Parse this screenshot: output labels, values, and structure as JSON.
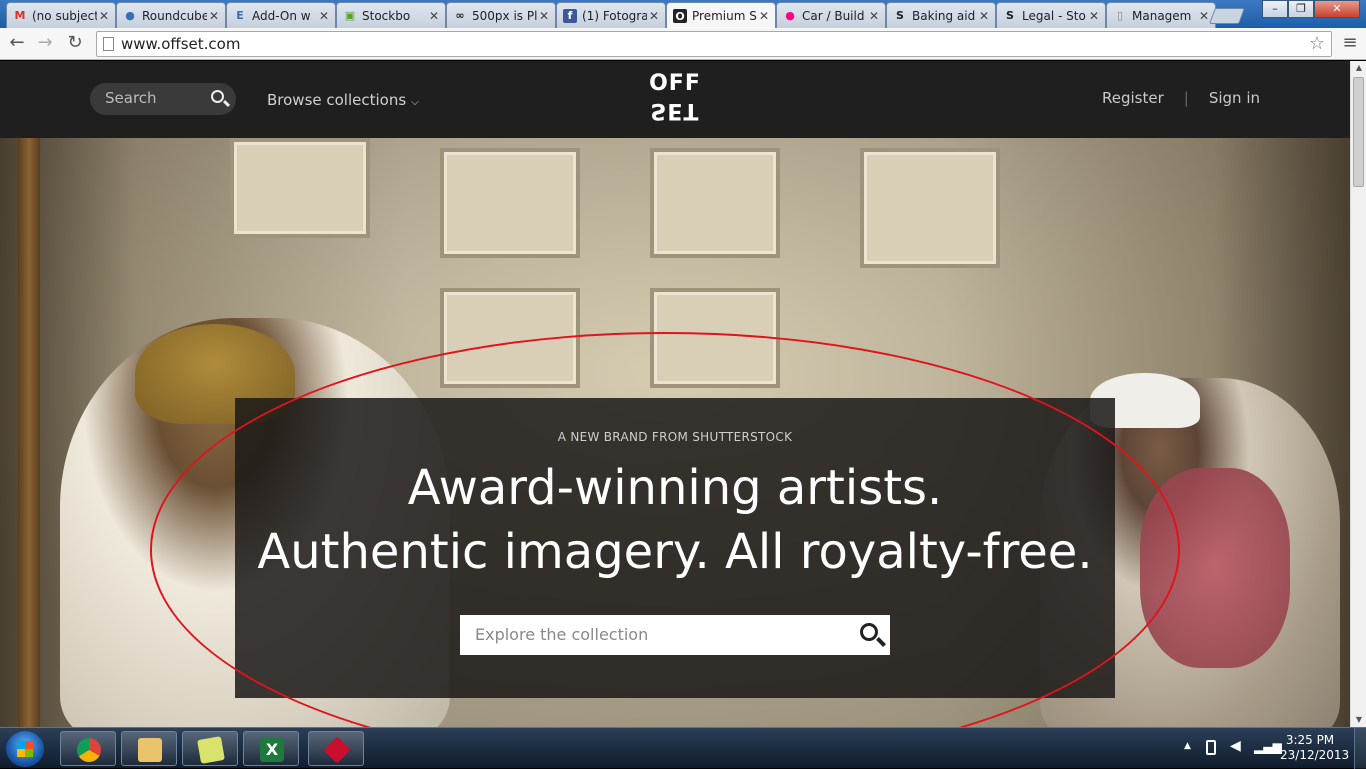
{
  "tabs": [
    {
      "title": "(no subject)",
      "icon": "gmail-icon",
      "color": "#d93025",
      "glyph": "M"
    },
    {
      "title": "Roundcube",
      "icon": "roundcube-icon",
      "color": "#3b6db5",
      "glyph": "●"
    },
    {
      "title": "Add-On w",
      "icon": "e-icon",
      "color": "#3b6db5",
      "glyph": "E"
    },
    {
      "title": "Stockbo",
      "icon": "stockbox-icon",
      "color": "#5aa02c",
      "glyph": "▣"
    },
    {
      "title": "500px is Pl",
      "icon": "500px-icon",
      "color": "#222222",
      "glyph": "∞"
    },
    {
      "title": "(1) Fotogra",
      "icon": "facebook-icon",
      "color": "#3b5998",
      "glyph": "f"
    },
    {
      "title": "Premium S",
      "icon": "offset-icon",
      "color": "#222222",
      "glyph": "O"
    },
    {
      "title": "Car / Build",
      "icon": "flickr-icon",
      "color": "#ff0084",
      "glyph": "●"
    },
    {
      "title": "Baking aid",
      "icon": "shutterstock-icon",
      "color": "#333333",
      "glyph": "S"
    },
    {
      "title": "Legal - Sto",
      "icon": "shutterstock-icon",
      "color": "#333333",
      "glyph": "S"
    },
    {
      "title": "Managem",
      "icon": "page-icon",
      "color": "#888888",
      "glyph": "▯"
    }
  ],
  "active_tab_index": 6,
  "url": "www.offset.com",
  "site": {
    "search_placeholder": "Search",
    "browse": "Browse collections",
    "logo_top": "OFF",
    "logo_bottom": "SET",
    "register": "Register",
    "separator": "|",
    "signin": "Sign in"
  },
  "hero": {
    "eyebrow": "A NEW BRAND FROM SHUTTERSTOCK",
    "headline_line1": "Award-winning artists.",
    "headline_line2": "Authentic imagery. All royalty-free.",
    "explore_placeholder": "Explore the collection"
  },
  "taskbar": {
    "apps": [
      {
        "name": "chrome-taskbar-button",
        "icon": "chrome-icon",
        "color": "#db4437"
      },
      {
        "name": "explorer-taskbar-button",
        "icon": "folder-icon",
        "color": "#e9c46a"
      },
      {
        "name": "notes-taskbar-button",
        "icon": "sticky-notes-icon",
        "color": "#d9e36b"
      },
      {
        "name": "excel-taskbar-button",
        "icon": "excel-icon",
        "color": "#1e7a3c"
      },
      {
        "name": "app-taskbar-button",
        "icon": "ruby-icon",
        "color": "#c8102e"
      }
    ],
    "time": "3:25 PM",
    "date": "23/12/2013"
  },
  "colors": {
    "site_header": "#1f1f1f",
    "overlay": "#1c1a18",
    "highlight_ellipse": "#e0141c"
  }
}
